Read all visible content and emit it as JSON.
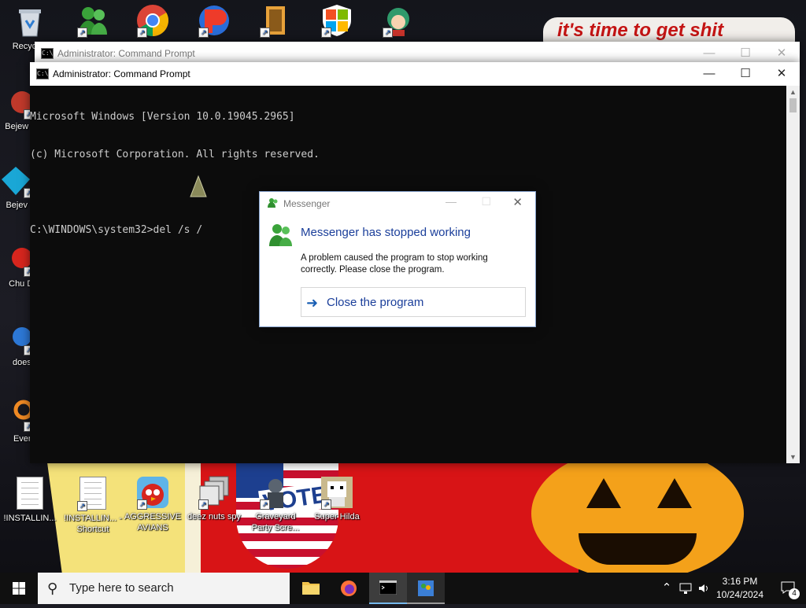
{
  "wallpaper": {
    "sign_text": "it's time to get shit"
  },
  "desktop_icons": [
    {
      "label": "Recyc",
      "icon": "recycle-bin-icon"
    },
    {
      "label": "Bejew Del",
      "icon": "bejeweled-icon"
    },
    {
      "label": "Bejev Del",
      "icon": "bejeweled-gem-icon"
    },
    {
      "label": "Chu Del",
      "icon": "chuzzle-icon"
    },
    {
      "label": "doesn",
      "icon": "blue-figure-icon"
    },
    {
      "label": "Every",
      "icon": "orange-app-icon"
    },
    {
      "label": "!INSTALLIN...",
      "icon": "document-icon"
    },
    {
      "label": "!INSTALLIN... - Shortcut",
      "icon": "document-icon"
    },
    {
      "label": "AGGRESSIVE AVIANS",
      "icon": "angry-bird-icon"
    },
    {
      "label": "deez nuts spy",
      "icon": "window-stack-icon"
    },
    {
      "label": "Graveyard Party Scre...",
      "icon": "graveyard-icon"
    },
    {
      "label": "Super Hilda",
      "icon": "pixel-character-icon"
    }
  ],
  "cmd_back": {
    "title": "Administrator: Command Prompt"
  },
  "cmd_front": {
    "title": "Administrator: Command Prompt",
    "lines": [
      "Microsoft Windows [Version 10.0.19045.2965]",
      "(c) Microsoft Corporation. All rights reserved.",
      "",
      "C:\\WINDOWS\\system32>del /s /"
    ]
  },
  "dialog": {
    "title": "Messenger",
    "heading": "Messenger has stopped working",
    "body": "A problem caused the program to stop working correctly. Please close the program.",
    "action": "Close the program"
  },
  "taskbar": {
    "search_placeholder": "Type here to search",
    "time": "3:16 PM",
    "date": "10/24/2024",
    "notification_count": "4"
  },
  "colors": {
    "dialog_heading": "#1a3e9a",
    "cmd_bg": "#0c0c0c",
    "taskbar_bg": "#101010",
    "accent": "#76b9ed"
  }
}
